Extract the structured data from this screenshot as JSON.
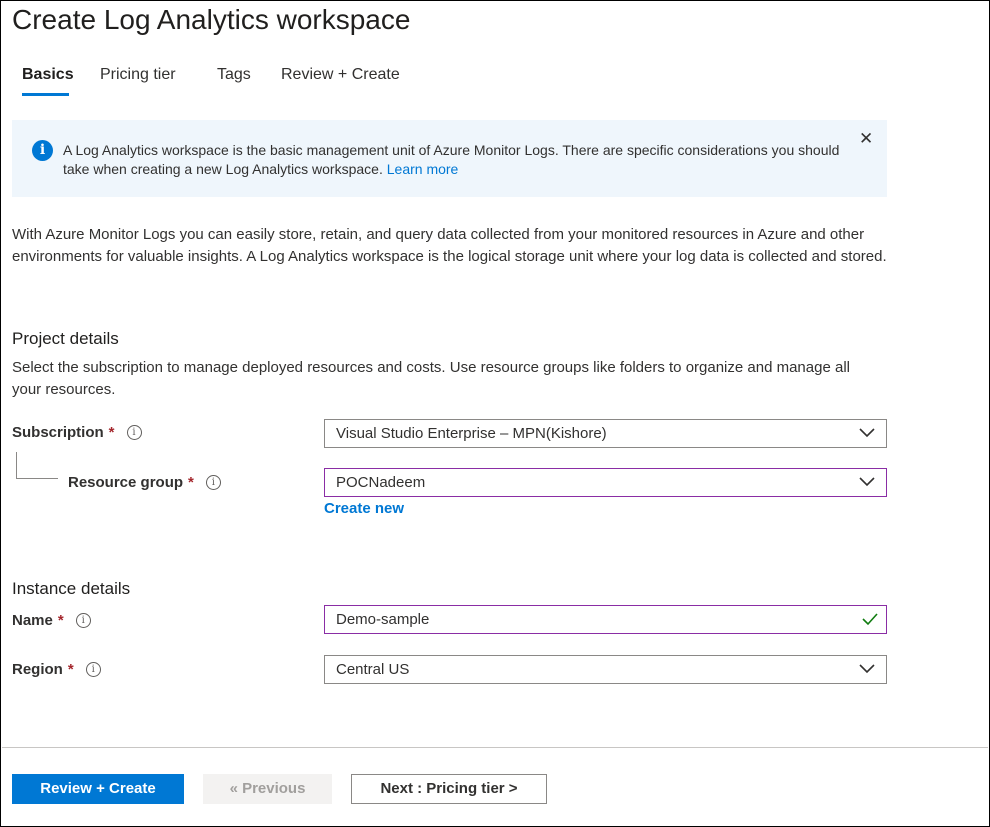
{
  "page": {
    "title": "Create Log Analytics workspace"
  },
  "tabs": [
    {
      "label": "Basics",
      "active": true
    },
    {
      "label": "Pricing tier",
      "active": false
    },
    {
      "label": "Tags",
      "active": false
    },
    {
      "label": "Review + Create",
      "active": false
    }
  ],
  "info_banner": {
    "icon": "info-icon",
    "text": "A Log Analytics workspace is the basic management unit of Azure Monitor Logs. There are specific considerations you should take when creating a new Log Analytics workspace.",
    "link": "Learn more",
    "close_icon": "close-icon"
  },
  "description": "With Azure Monitor Logs you can easily store, retain, and query data collected from your monitored resources in Azure and other environments for valuable insights. A Log Analytics workspace is the logical storage unit where your log data is collected and stored.",
  "project_details": {
    "title": "Project details",
    "description": "Select the subscription to manage deployed resources and costs. Use resource groups like folders to organize and manage all your resources.",
    "subscription": {
      "label": "Subscription",
      "required": "*",
      "info": "i",
      "value": "Visual Studio Enterprise – MPN(Kishore)"
    },
    "resource_group": {
      "label": "Resource group",
      "required": "*",
      "info": "i",
      "value": "POCNadeem",
      "create_new": "Create new"
    }
  },
  "instance_details": {
    "title": "Instance details",
    "name": {
      "label": "Name",
      "required": "*",
      "info": "i",
      "value": "Demo-sample"
    },
    "region": {
      "label": "Region",
      "required": "*",
      "info": "i",
      "value": "Central US"
    }
  },
  "footer": {
    "review_create": "Review + Create",
    "previous": "« Previous",
    "next": "Next : Pricing tier >"
  },
  "colors": {
    "accent": "#0078d4",
    "banner_bg": "#eff6fc",
    "required": "#a4262c",
    "focus_border": "#8a2da5",
    "valid_check": "#107c10"
  }
}
